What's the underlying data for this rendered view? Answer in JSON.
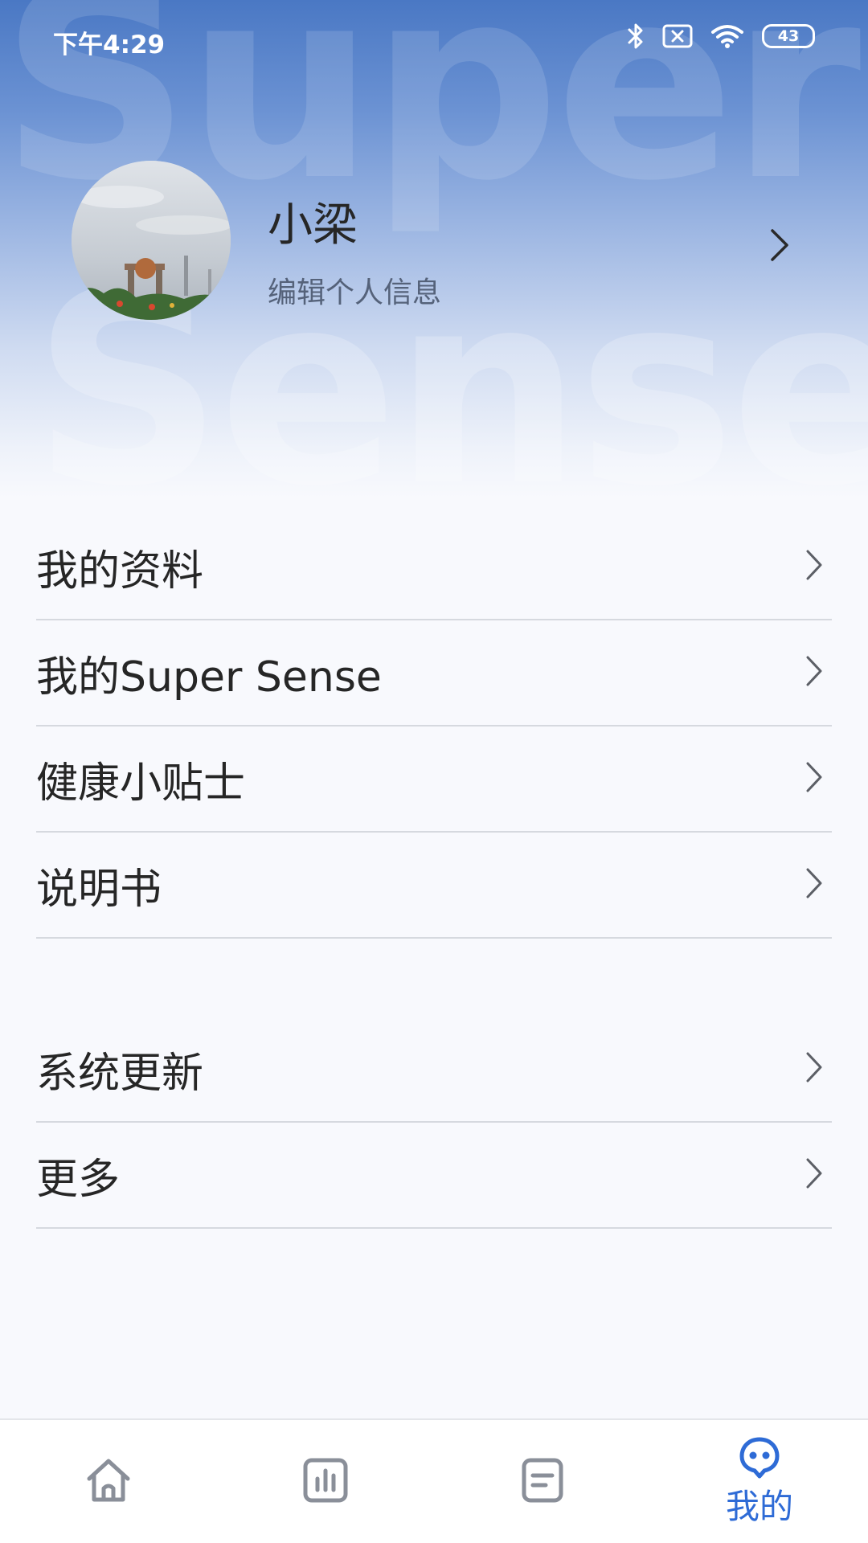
{
  "status_bar": {
    "time": "下午4:29",
    "battery": "43",
    "icons": [
      "bluetooth-icon",
      "sim-error-icon",
      "wifi-icon",
      "battery-icon"
    ]
  },
  "header": {
    "watermark": "Super Sense"
  },
  "profile": {
    "name": "小梁",
    "subtitle": "编辑个人信息"
  },
  "menu_group_1": [
    {
      "label": "我的资料"
    },
    {
      "label": "我的Super Sense"
    },
    {
      "label": "健康小贴士"
    },
    {
      "label": "说明书"
    }
  ],
  "menu_group_2": [
    {
      "label": "系统更新"
    },
    {
      "label": "更多"
    }
  ],
  "bottom_nav": {
    "items": [
      {
        "icon": "home-icon"
      },
      {
        "icon": "bar-chart-icon"
      },
      {
        "icon": "document-icon"
      },
      {
        "icon": "robot-face-icon",
        "label": "我的"
      }
    ],
    "active_color": "#2e6bd6",
    "inactive_color": "#8a8f99"
  },
  "colors": {
    "header_top": "#4a78c4",
    "page_background": "#f8f9fd",
    "divider": "#d6d9df"
  }
}
